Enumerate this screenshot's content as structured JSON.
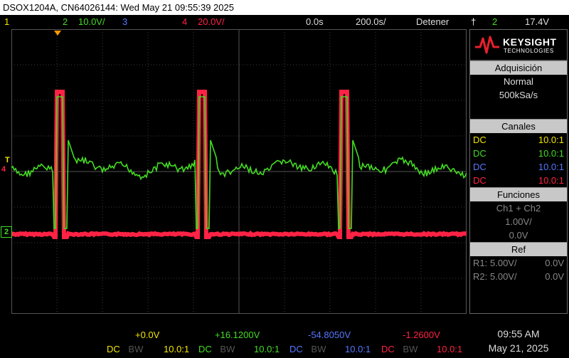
{
  "title": "DSOX1204A, CN64026144: Wed May 21 09:55:39 2025",
  "status": {
    "ch1": "1",
    "ch2": "2",
    "ch2_scale": "10.0V/",
    "ch3": "3",
    "ch4": "4",
    "ch4_scale": "20.0V/",
    "delay": "0.0s",
    "timebase": "200.0s/",
    "run_state": "Detener",
    "trigger_icon": "†",
    "trigger_source": "2",
    "trigger_level": "17.4V"
  },
  "colors": {
    "ch1": "#f2e600",
    "ch2": "#44dd22",
    "ch3": "#5577ff",
    "ch4": "#ff2244",
    "header_bg": "#c8c8c8"
  },
  "brand": {
    "name": "KEYSIGHT",
    "sub": "TECHNOLOGIES"
  },
  "acquisition": {
    "header": "Adquisición",
    "mode": "Normal",
    "rate": "500kSa/s"
  },
  "channels": {
    "header": "Canales",
    "rows": [
      {
        "coupling": "DC",
        "probe": "10.0:1"
      },
      {
        "coupling": "DC",
        "probe": "10.0:1"
      },
      {
        "coupling": "DC",
        "probe": "10.0:1"
      },
      {
        "coupling": "DC",
        "probe": "10.0:1"
      }
    ]
  },
  "functions": {
    "header": "Funciones",
    "expr": "Ch1 + Ch2",
    "scale": "1.00V/",
    "offset": "0.0V"
  },
  "ref": {
    "header": "Ref",
    "rows": [
      {
        "label": "R1:",
        "scale": "5.00V/",
        "offset": "0.0V"
      },
      {
        "label": "R2:",
        "scale": "5.00V/",
        "offset": "0.0V"
      }
    ]
  },
  "markers": {
    "trigger": "T",
    "ch4": "4",
    "ch2": "2"
  },
  "bottom": {
    "ch1": {
      "offset": "+0.0V",
      "coupling": "DC",
      "bw": "BW",
      "probe": "10.0:1"
    },
    "ch2": {
      "offset": "+16.1200V",
      "coupling": "DC",
      "bw": "BW",
      "probe": "10.0:1"
    },
    "ch3": {
      "offset": "-54.8050V",
      "coupling": "DC",
      "bw": "BW",
      "probe": "10.0:1"
    },
    "ch4": {
      "offset": "-1.2600V",
      "coupling": "DC",
      "bw": "BW",
      "probe": "10.0:1"
    },
    "time": "09:55 AM",
    "date": "May 21, 2025"
  }
}
